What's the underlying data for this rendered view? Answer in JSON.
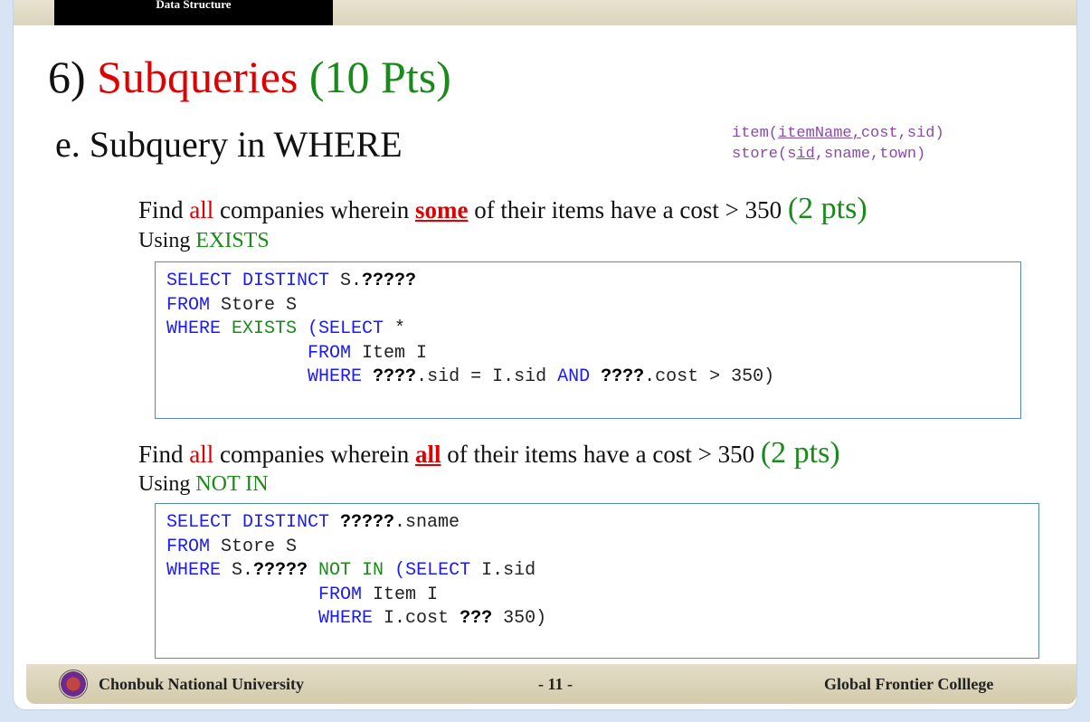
{
  "header": {
    "course_label": "Data Structure"
  },
  "title": {
    "number": "6)",
    "main": "Subqueries",
    "points": "(10 Pts)"
  },
  "subtitle": "e.  Subquery in WHERE",
  "schema": {
    "item": {
      "prefix": "item(",
      "key": "itemName,",
      "rest": "cost,sid)"
    },
    "store": {
      "prefix": "store(s",
      "key": "id",
      "rest": ",sname,town)"
    }
  },
  "q1": {
    "t1": "Find ",
    "t2": "all",
    "t3": " companies wherein ",
    "t4": "some",
    "t5": " of their items have a cost > 350 ",
    "pts": "(2 pts)",
    "using_prefix": "Using ",
    "using_method": "EXISTS"
  },
  "code1": {
    "l1_kw": "SELECT DISTINCT ",
    "l1_txt": "S.",
    "l1_q": "?????",
    "l2_kw": "FROM ",
    "l2_txt": "Store S",
    "l3_kw": "WHERE ",
    "l3_g": "EXISTS ",
    "l3_kw2": "(SELECT ",
    "l3_txt": "*",
    "l4_pad": "             ",
    "l4_kw": "FROM ",
    "l4_txt": "Item I",
    "l5_pad": "             ",
    "l5_kw": "WHERE ",
    "l5_q1": "????",
    "l5_txt1": ".sid = I.sid ",
    "l5_kw2": "AND ",
    "l5_q2": "????",
    "l5_txt2": ".cost > 350)"
  },
  "q2": {
    "t1": "Find ",
    "t2": "all",
    "t3": " companies wherein ",
    "t4": "all",
    "t5": " of their items have a cost > 350 ",
    "pts": "(2 pts)",
    "using_prefix": "Using ",
    "using_method": "NOT IN"
  },
  "code2": {
    "l1_kw": "SELECT DISTINCT ",
    "l1_q": "?????",
    "l1_txt": ".sname",
    "l2_kw": "FROM ",
    "l2_txt": "Store S",
    "l3_kw": "WHERE ",
    "l3_txt": "S.",
    "l3_q": "?????",
    "l3_g": " NOT IN ",
    "l3_kw2": "(SELECT ",
    "l3_txt2": "I.sid",
    "l4_pad": "              ",
    "l4_kw": "FROM ",
    "l4_txt": "Item I",
    "l5_pad": "              ",
    "l5_kw": "WHERE ",
    "l5_txt": "I.cost ",
    "l5_q": "???",
    "l5_txt2": " 350)"
  },
  "footer": {
    "university": "Chonbuk National University",
    "page": "- 11 -",
    "college": "Global Frontier Colllege"
  }
}
